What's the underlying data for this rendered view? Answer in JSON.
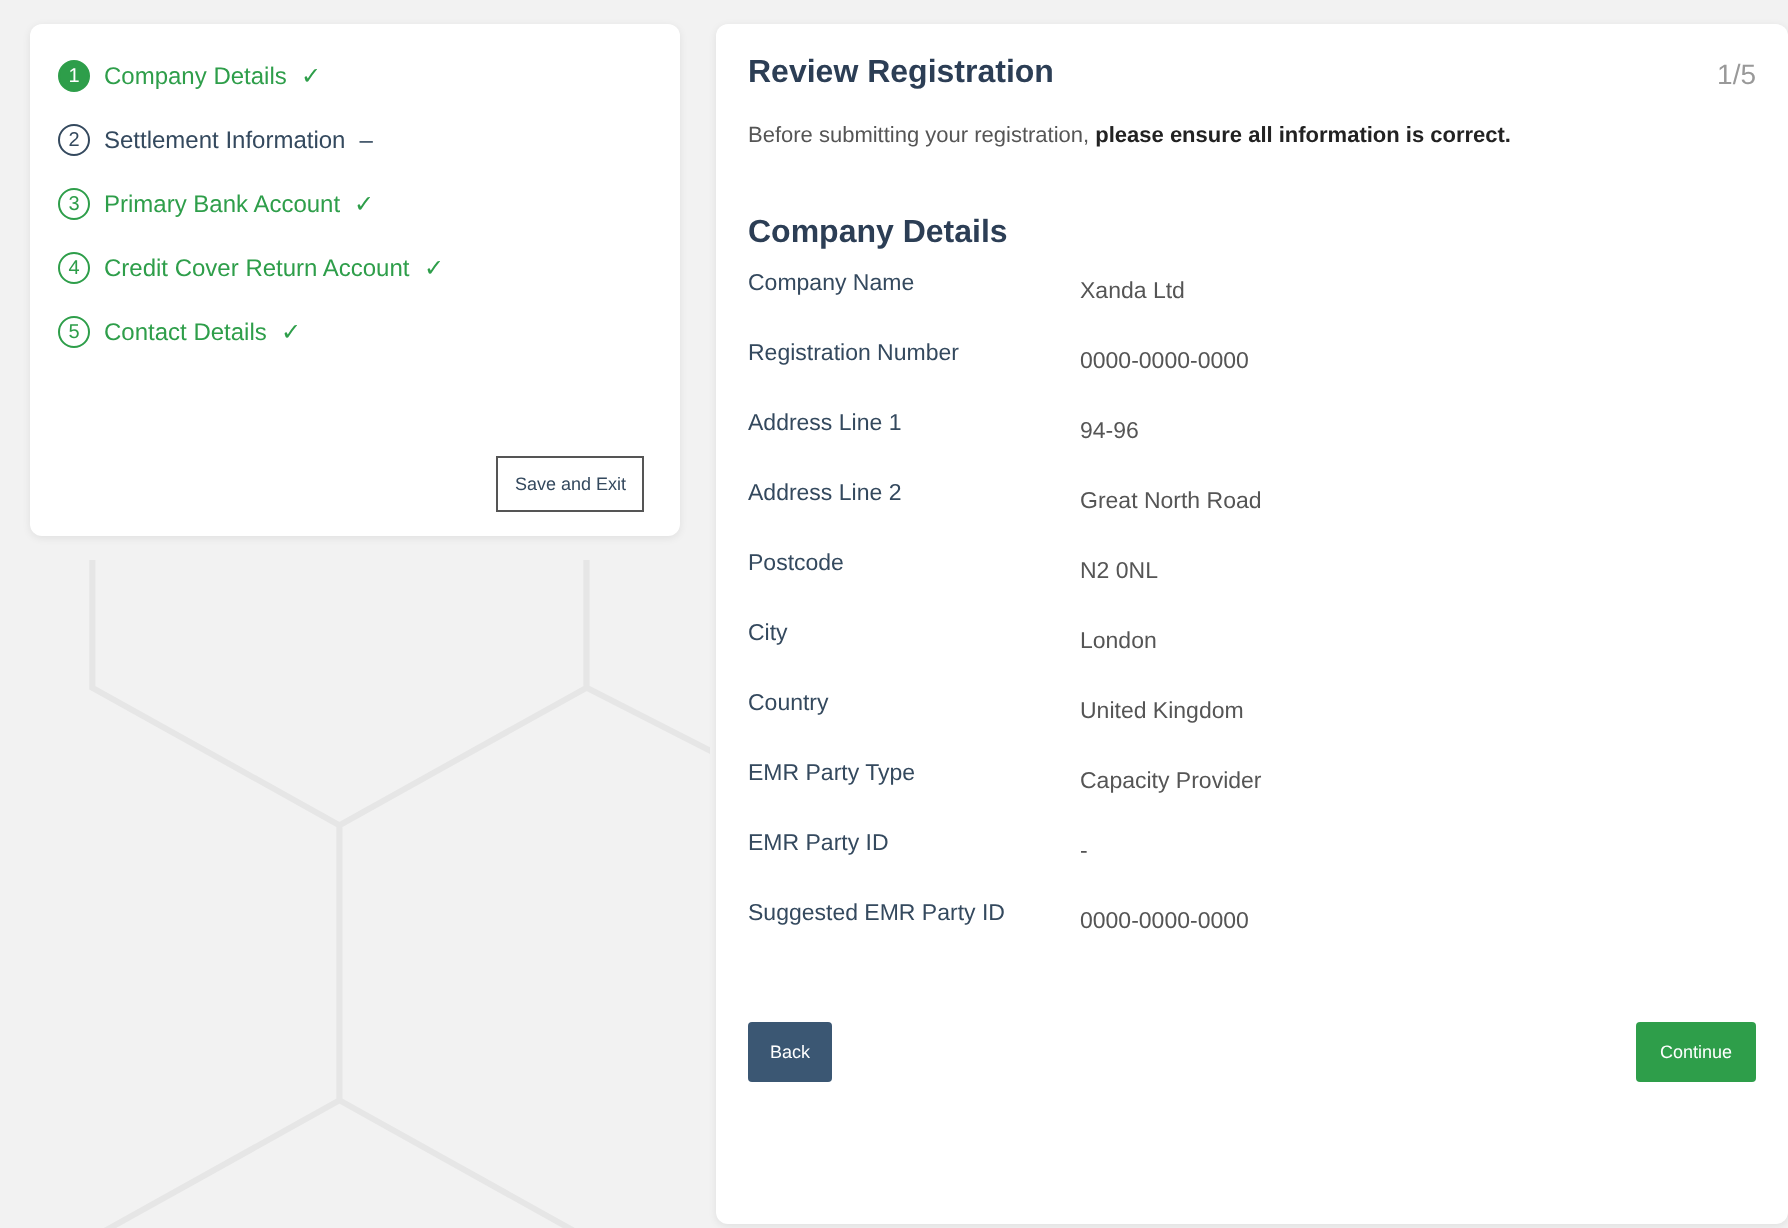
{
  "steps": [
    {
      "number": "1",
      "label": "Company Details",
      "mark": "✓",
      "complete": true,
      "selected": true
    },
    {
      "number": "2",
      "label": "Settlement Information",
      "mark": "–",
      "complete": false,
      "selected": false
    },
    {
      "number": "3",
      "label": "Primary Bank Account",
      "mark": "✓",
      "complete": true,
      "selected": false
    },
    {
      "number": "4",
      "label": "Credit Cover Return Account",
      "mark": "✓",
      "complete": true,
      "selected": false
    },
    {
      "number": "5",
      "label": "Contact Details",
      "mark": "✓",
      "complete": true,
      "selected": false
    }
  ],
  "save_button": "Save and Exit",
  "review": {
    "title": "Review Registration",
    "page": "1/5",
    "intro": "Before submitting your registration, **please ensure all information is correct.**",
    "section": "Company Details",
    "fields": [
      {
        "label": "Company Name",
        "value": "Xanda Ltd"
      },
      {
        "label": "Registration Number",
        "value": "0000-0000-0000"
      },
      {
        "label": "Address Line 1",
        "value": "94-96"
      },
      {
        "label": "Address Line 2",
        "value": "Great North Road"
      },
      {
        "label": "Postcode",
        "value": "N2 0NL"
      },
      {
        "label": "City",
        "value": "London"
      },
      {
        "label": "Country",
        "value": "United Kingdom"
      },
      {
        "label": "EMR Party Type",
        "value": "Capacity Provider"
      },
      {
        "label": "EMR Party ID",
        "value": "-"
      },
      {
        "label": "Suggested EMR Party ID",
        "value": "0000-0000-0000"
      }
    ]
  },
  "buttons": {
    "back": "Back",
    "continue": "Continue"
  }
}
